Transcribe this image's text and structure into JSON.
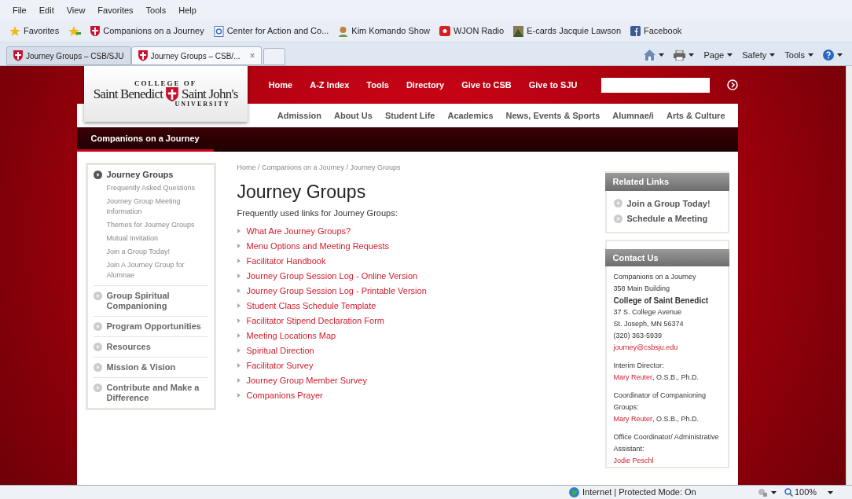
{
  "menu_bar": [
    "File",
    "Edit",
    "View",
    "Favorites",
    "Tools",
    "Help"
  ],
  "favorites_bar": {
    "label": "Favorites",
    "items": [
      {
        "label": "Companions on a Journey",
        "kind": "shield"
      },
      {
        "label": "Center for Action and Co...",
        "kind": "page"
      },
      {
        "label": "Kim Komando Show",
        "kind": "person"
      },
      {
        "label": "WJON Radio",
        "kind": "radio"
      },
      {
        "label": "E-cards Jacquie Lawson",
        "kind": "picture"
      },
      {
        "label": "Facebook",
        "kind": "facebook"
      }
    ]
  },
  "tabs": [
    {
      "label": "Journey Groups – CSB/SJU",
      "selected": false
    },
    {
      "label": "Journey Groups – CSB/...",
      "selected": true,
      "close": "×"
    }
  ],
  "command_bar": [
    "Page",
    "Safety",
    "Tools"
  ],
  "logo": {
    "top": "COLLEGE OF",
    "left": "Saint Benedict",
    "right": "Saint John's",
    "bottom": "UNIVERSITY"
  },
  "top_nav": [
    "Home",
    "A-Z Index",
    "Tools",
    "Directory",
    "Give to CSB",
    "Give to SJU"
  ],
  "main_nav": [
    "Admission",
    "About Us",
    "Student Life",
    "Academics",
    "News, Events & Sports",
    "Alumnae/i",
    "Arts & Culture"
  ],
  "section_bar": {
    "label": "Companions on a Journey"
  },
  "sidebar": [
    {
      "label": "Journey Groups",
      "selected": true,
      "children": [
        "Frequently Asked Questions",
        "Journey Group Meeting Information",
        "Themes for Journey Groups",
        "Mutual Invitation",
        "Join a Group Today!",
        "Join A Journey Group for Alumnae"
      ]
    },
    {
      "label": "Group Spiritual Companioning",
      "selected": false
    },
    {
      "label": "Program Opportunities",
      "selected": false
    },
    {
      "label": "Resources",
      "selected": false
    },
    {
      "label": "Mission & Vision",
      "selected": false
    },
    {
      "label": "Contribute and Make a Difference",
      "selected": false
    }
  ],
  "breadcrumb": "Home / Companions on a Journey / Journey Groups",
  "title": "Journey Groups",
  "intro": "Frequently used links for Journey Groups:",
  "links": [
    "What Are Journey Groups?",
    "Menu Options and Meeting Requests",
    "Facilitator Handbook",
    "Journey Group Session Log - Online Version",
    "Journey Group Session Log - Printable Version",
    "Student Class Schedule Template",
    "Facilitator Stipend Declaration Form",
    "Meeting Locations Map",
    "Spiritual Direction",
    "Facilitator Survey",
    "Journey Group Member Survey",
    "Companions Prayer"
  ],
  "related_links": {
    "title": "Related Links",
    "items": [
      "Join a Group Today!",
      "Schedule a Meeting"
    ]
  },
  "contact": {
    "title": "Contact Us",
    "blocks": [
      [
        {
          "kind": "text",
          "text": "Companions on a Journey"
        },
        {
          "kind": "text",
          "text": "358 Main Building"
        },
        {
          "kind": "bold",
          "text": "College of Saint Benedict"
        },
        {
          "kind": "text",
          "text": "37 S. College Avenue"
        },
        {
          "kind": "text",
          "text": "St. Joseph, MN 56374"
        },
        {
          "kind": "text",
          "text": "(320) 363-5939"
        },
        {
          "kind": "link",
          "text": "journey@csbsju.edu"
        }
      ],
      [
        {
          "kind": "text",
          "text": "Interim Director:"
        },
        {
          "kind": "link",
          "text": "Mary Reuter",
          "suffix": ", O.S.B., Ph.D."
        }
      ],
      [
        {
          "kind": "text",
          "text": "Coordinator of Companioning Groups:"
        },
        {
          "kind": "link",
          "text": "Mary Reuter",
          "suffix": ", O.S.B., Ph.D."
        }
      ],
      [
        {
          "kind": "text",
          "text": "Office Coordinator/ Administrative Assistant:"
        },
        {
          "kind": "link",
          "text": "Jodie Peschl"
        }
      ]
    ]
  },
  "status_bar": {
    "zone": "Internet | Protected Mode: On",
    "zoom": "100%"
  }
}
